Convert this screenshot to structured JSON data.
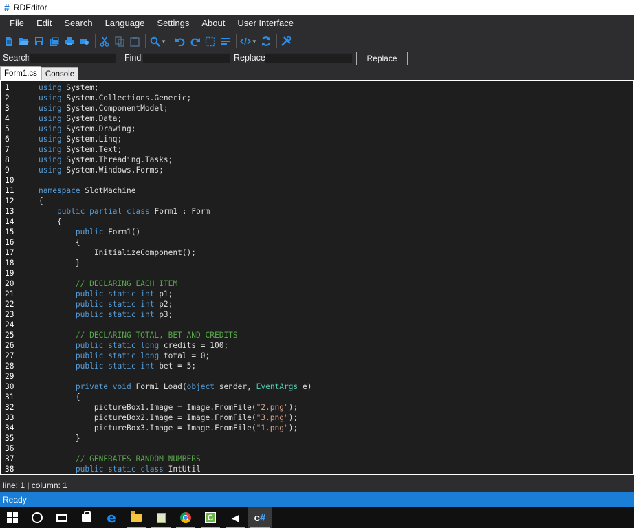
{
  "window": {
    "title": "RDEditor",
    "icon": "hash-icon"
  },
  "menu": [
    "File",
    "Edit",
    "Search",
    "Language",
    "Settings",
    "About",
    "User Interface"
  ],
  "toolbar": {
    "icons": [
      "new-file-icon",
      "open-folder-icon",
      "save-icon",
      "save-all-icon",
      "print-icon",
      "print-preview-icon",
      "cut-icon",
      "copy-icon",
      "paste-icon",
      "search-icon",
      "undo-icon",
      "redo-icon",
      "select-all-icon",
      "format-icon",
      "code-tag-icon",
      "refresh-icon",
      "tools-icon"
    ]
  },
  "search": {
    "search_label": "Search",
    "find_label": "Find",
    "replace_label": "Replace",
    "search_value": "",
    "find_value": "",
    "replace_value": "",
    "replace_button": "Replace"
  },
  "tabs": [
    {
      "label": "Form1.cs",
      "active": true
    },
    {
      "label": "Console",
      "active": false
    }
  ],
  "editor": {
    "lines": [
      "using System;",
      "using System.Collections.Generic;",
      "using System.ComponentModel;",
      "using System.Data;",
      "using System.Drawing;",
      "using System.Linq;",
      "using System.Text;",
      "using System.Threading.Tasks;",
      "using System.Windows.Forms;",
      "",
      "namespace SlotMachine",
      "{",
      "    public partial class Form1 : Form",
      "    {",
      "        public Form1()",
      "        {",
      "            InitializeComponent();",
      "        }",
      "",
      "        // DECLARING EACH ITEM",
      "        public static int p1;",
      "        public static int p2;",
      "        public static int p3;",
      "",
      "        // DECLARING TOTAL, BET AND CREDITS",
      "        public static long credits = 100;",
      "        public static long total = 0;",
      "        public static int bet = 5;",
      "",
      "        private void Form1_Load(object sender, EventArgs e)",
      "        {",
      "            pictureBox1.Image = Image.FromFile(\"2.png\");",
      "            pictureBox2.Image = Image.FromFile(\"3.png\");",
      "            pictureBox3.Image = Image.FromFile(\"1.png\");",
      "        }",
      "",
      "        // GENERATES RANDOM NUMBERS",
      "        public static class IntUtil"
    ],
    "colors": {
      "background": "#1e1e1e",
      "keyword": "#569cd6",
      "type": "#4ec9b0",
      "comment": "#57a64a",
      "string": "#d69d85",
      "text": "#dcdcdc"
    }
  },
  "status": {
    "position": "line: 1 | column: 1",
    "state": "Ready",
    "accent": "#1a7ed6"
  },
  "taskbar": {
    "items": [
      "windows-start-icon",
      "cortana-circle-icon",
      "task-view-icon",
      "store-icon",
      "edge-icon",
      "file-explorer-icon",
      "notepad-icon",
      "chrome-icon",
      "ccleaner-icon",
      "unity-icon",
      "rdeditor-icon"
    ]
  }
}
